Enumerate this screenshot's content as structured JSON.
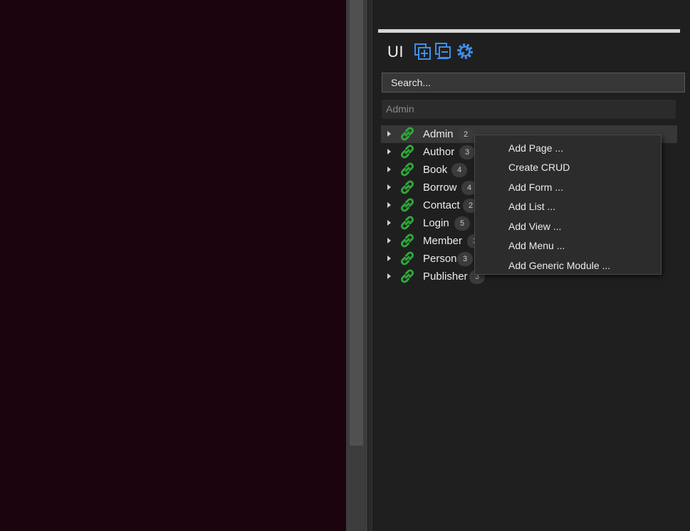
{
  "panel": {
    "title": "UI",
    "toolbar": [
      {
        "name": "add-layer-icon",
        "color": "#3f8ee8"
      },
      {
        "name": "collapse-layer-icon",
        "color": "#3f8ee8"
      },
      {
        "name": "settings-gear-icon",
        "color": "#3f8ee8"
      }
    ],
    "search": {
      "placeholder": "Search...",
      "value": ""
    },
    "filter": {
      "value": "Admin"
    }
  },
  "tree": {
    "items": [
      {
        "label": "Admin",
        "count": "2",
        "selected": true
      },
      {
        "label": "Author",
        "count": "3"
      },
      {
        "label": "Book",
        "count": "4"
      },
      {
        "label": "Borrow",
        "count": "4"
      },
      {
        "label": "Contact",
        "count": "2"
      },
      {
        "label": "Login",
        "count": "5"
      },
      {
        "label": "Member",
        "count": "3"
      },
      {
        "label": "Person",
        "count": "3"
      },
      {
        "label": "Publisher",
        "count": "3"
      }
    ]
  },
  "context_menu": {
    "items": [
      {
        "label": "Add Page ..."
      },
      {
        "label": "Create CRUD"
      },
      {
        "label": "Add Form ..."
      },
      {
        "label": "Add List ..."
      },
      {
        "label": "Add View ..."
      },
      {
        "label": "Add Menu ..."
      },
      {
        "label": "Add Generic Module ..."
      }
    ]
  },
  "colors": {
    "background": "#1b040d",
    "panel": "#1f1f1f",
    "accent_icon": "#3f8ee8",
    "link_icon": "#2fa83a"
  }
}
